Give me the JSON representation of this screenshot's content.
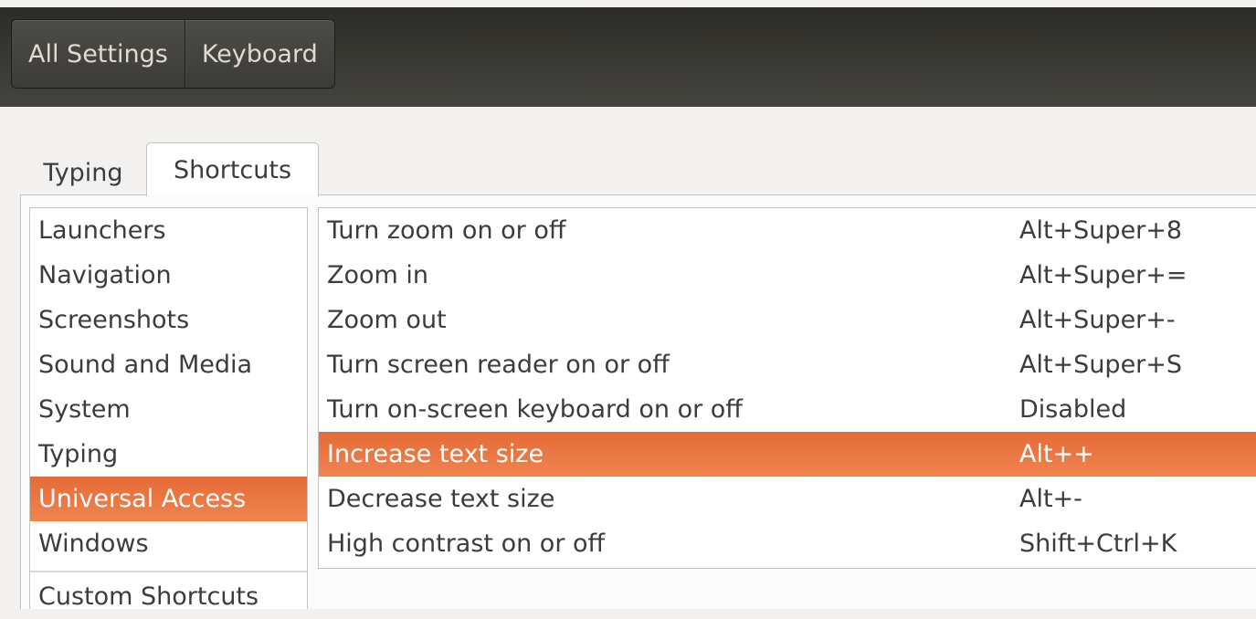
{
  "header": {
    "breadcrumbs": [
      "All Settings",
      "Keyboard"
    ]
  },
  "tabs": [
    {
      "label": "Typing",
      "active": false
    },
    {
      "label": "Shortcuts",
      "active": true
    }
  ],
  "categories": [
    {
      "label": "Launchers"
    },
    {
      "label": "Navigation"
    },
    {
      "label": "Screenshots"
    },
    {
      "label": "Sound and Media"
    },
    {
      "label": "System"
    },
    {
      "label": "Typing"
    },
    {
      "label": "Universal Access",
      "selected": true
    },
    {
      "label": "Windows"
    },
    {
      "label": "Custom Shortcuts"
    }
  ],
  "shortcuts": [
    {
      "name": "Turn zoom on or off",
      "accel": "Alt+Super+8"
    },
    {
      "name": "Zoom in",
      "accel": "Alt+Super+="
    },
    {
      "name": "Zoom out",
      "accel": "Alt+Super+-"
    },
    {
      "name": "Turn screen reader on or off",
      "accel": "Alt+Super+S"
    },
    {
      "name": "Turn on-screen keyboard on or off",
      "accel": "Disabled"
    },
    {
      "name": "Increase text size",
      "accel": "Alt++",
      "selected": true
    },
    {
      "name": "Decrease text size",
      "accel": "Alt+-"
    },
    {
      "name": "High contrast on or off",
      "accel": "Shift+Ctrl+K"
    }
  ],
  "colors": {
    "selection": "#e95420",
    "header": "#3c3b37"
  }
}
